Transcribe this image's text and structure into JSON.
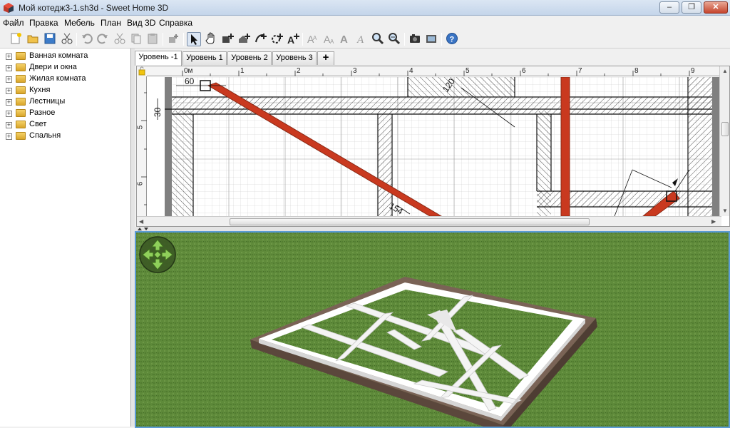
{
  "window": {
    "title": "Мой котедж3-1.sh3d - Sweet Home 3D",
    "minimize": "–",
    "maximize": "❐",
    "close": "✕"
  },
  "menu": [
    "Файл",
    "Правка",
    "Мебель",
    "План",
    "Вид 3D",
    "Справка"
  ],
  "toolbar": {
    "icons": [
      "new-home-icon",
      "open-icon",
      "save-icon",
      "cut-icon",
      "undo-icon",
      "redo-icon",
      "cut-icon",
      "copy-icon",
      "paste-icon",
      "add-furniture-icon",
      "select-mode-icon",
      "pan-mode-icon",
      "create-walls-icon",
      "create-rooms-icon",
      "create-dimensions-icon",
      "create-labels-icon",
      "add-text-icon",
      "text-style-bold-icon",
      "text-style-italic-icon",
      "increase-text-icon",
      "decrease-text-icon",
      "zoom-in-icon",
      "zoom-out-icon",
      "create-photo-icon",
      "create-video-icon",
      "help-icon"
    ]
  },
  "catalog": {
    "categories": [
      "Ванная комната",
      "Двери и окна",
      "Жилая комната",
      "Кухня",
      "Лестницы",
      "Разное",
      "Свет",
      "Спальня"
    ]
  },
  "plan": {
    "tabs": [
      "Уровень -1",
      "Уровень 1",
      "Уровень 2",
      "Уровень 3"
    ],
    "active_tab": "Уровень -1",
    "add_level": "+",
    "ruler_x": [
      "0м",
      "1",
      "2",
      "3",
      "4",
      "5",
      "6",
      "7",
      "8",
      "9"
    ],
    "ruler_y": [
      "5",
      "6"
    ],
    "dimension_labels": [
      "60",
      "30",
      "120",
      "154"
    ]
  },
  "view3d": {
    "navigation": "navigation-arrows",
    "ground_color": "#5e8a3a",
    "wall_color": "#ffffff",
    "foundation_color": "#6e5a4e"
  },
  "colors": {
    "wall_hatch": "#000000",
    "red_wall": "#c9391f",
    "selection_border": "#5b9bd5"
  }
}
